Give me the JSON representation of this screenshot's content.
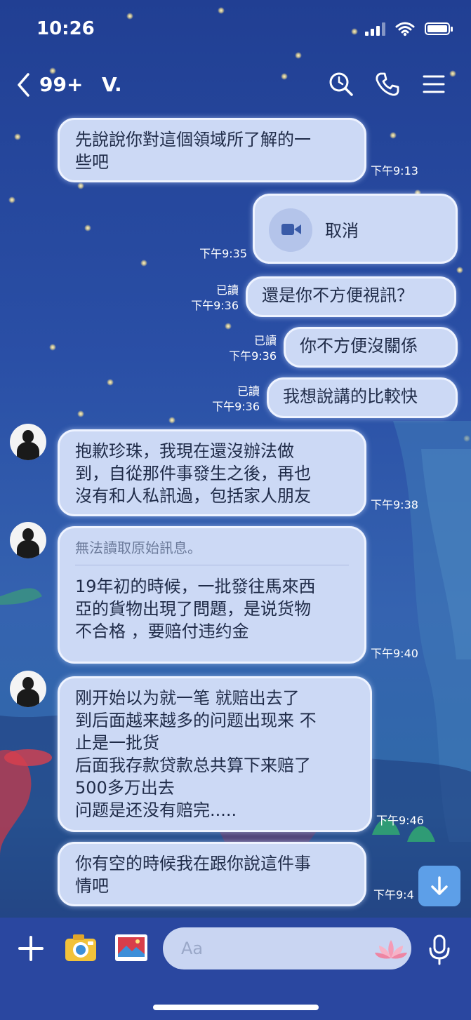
{
  "status_bar": {
    "time": "10:26"
  },
  "header": {
    "back_icon": "chevron-left-icon",
    "unread_count": "99+",
    "contact_name": "V.",
    "icons": [
      "search-icon",
      "phone-icon",
      "menu-icon"
    ]
  },
  "messages": [
    {
      "side": "received-no-avatar",
      "text": "先說說你對這個領域所了解的一些吧",
      "time": "下午9:13"
    },
    {
      "side": "sent",
      "type": "video-call",
      "text": "取消",
      "time": "下午9:35"
    },
    {
      "side": "sent",
      "text": "還是你不方便視訊？",
      "read": "已讀",
      "time": "下午9:36"
    },
    {
      "side": "sent",
      "text": "你不方便沒關係",
      "read": "已讀",
      "time": "下午9:36"
    },
    {
      "side": "sent",
      "text": "我想說講的比較快",
      "read": "已讀",
      "time": "下午9:36"
    },
    {
      "side": "received",
      "text": "抱歉珍珠，我現在還沒辦法做到，自從那件事發生之後，再也沒有和人私訊過，包括家人朋友",
      "time": "下午9:38"
    },
    {
      "side": "received",
      "quoted": "無法讀取原始訊息。",
      "text": "19年初的時候，一批發往馬來西亞的貨物出現了問題，是说货物不合格 ，要赔付违约金",
      "time": "下午9:40"
    },
    {
      "side": "received",
      "text": "刚开始以为就一笔 就赔出去了到后面越来越多的问题出现来 不止是一批货后面我存款贷款总共算下来赔了500多万出去问题是还没有赔完.....",
      "time": "下午9:46"
    },
    {
      "side": "received-no-avatar",
      "text": "你有空的時候我在跟你說這件事情吧",
      "time": "下午9:4"
    }
  ],
  "lines": {
    "m0": [
      "先說說你對這個領域所了解的一",
      "些吧"
    ],
    "m5": [
      "抱歉珍珠，我現在還沒辦法做",
      "到，自從那件事發生之後，再也",
      "沒有和人私訊過，包括家人朋友"
    ],
    "m6": [
      "19年初的時候，一批發往馬來西",
      "亞的貨物出現了問題，是说货物",
      "不合格 ，要赔付违约金"
    ],
    "m7": [
      "刚开始以为就一笔 就赔出去了",
      "到后面越来越多的问题出现来 不",
      "止是一批货",
      "后面我存款贷款总共算下来赔了",
      "500多万出去",
      "问题是还没有赔完....."
    ],
    "m8": [
      "你有空的時候我在跟你說這件事",
      "情吧"
    ]
  },
  "input": {
    "placeholder": "Aa"
  },
  "colors": {
    "bubble": "#ccd9f5",
    "background": "#2a4fa6",
    "accent": "#5d9fe8"
  }
}
